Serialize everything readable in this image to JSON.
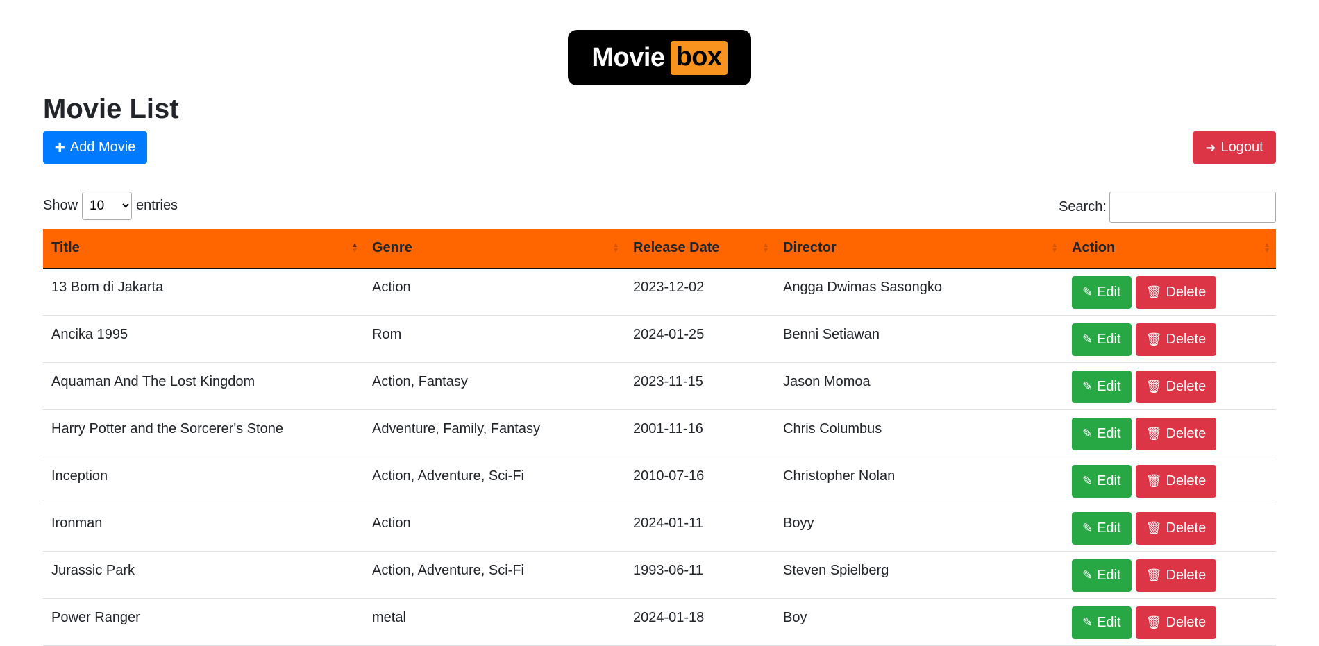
{
  "logo": {
    "word1": "Movie",
    "word2": "box"
  },
  "page_title": "Movie List",
  "buttons": {
    "add_movie": "Add Movie",
    "logout": "Logout"
  },
  "icons": {
    "plus": "plus-icon",
    "logout": "sign-out-icon",
    "edit": "edit-icon",
    "delete": "trash-icon"
  },
  "colors": {
    "header_bg": "#ff6600",
    "primary": "#007bff",
    "success": "#28a745",
    "danger": "#dc3545"
  },
  "controls": {
    "show_label": "Show",
    "entries_label": "entries",
    "page_length": "10",
    "search_label": "Search:",
    "search_value": ""
  },
  "table": {
    "columns": [
      "Title",
      "Genre",
      "Release Date",
      "Director",
      "Action"
    ],
    "sorted_column": "Title",
    "sort_direction": "ascending",
    "edit_label": "Edit",
    "delete_label": "Delete",
    "rows": [
      {
        "title": "13 Bom di Jakarta",
        "genre": "Action",
        "release_date": "2023-12-02",
        "director": "Angga Dwimas Sasongko"
      },
      {
        "title": "Ancika 1995",
        "genre": "Rom",
        "release_date": "2024-01-25",
        "director": "Benni Setiawan"
      },
      {
        "title": "Aquaman And The Lost Kingdom",
        "genre": "Action, Fantasy",
        "release_date": "2023-11-15",
        "director": "Jason Momoa"
      },
      {
        "title": "Harry Potter and the Sorcerer's Stone",
        "genre": "Adventure, Family, Fantasy",
        "release_date": "2001-11-16",
        "director": "Chris Columbus"
      },
      {
        "title": "Inception",
        "genre": "Action, Adventure, Sci-Fi",
        "release_date": "2010-07-16",
        "director": "Christopher Nolan"
      },
      {
        "title": "Ironman",
        "genre": "Action",
        "release_date": "2024-01-11",
        "director": "Boyy"
      },
      {
        "title": "Jurassic Park",
        "genre": "Action, Adventure, Sci-Fi",
        "release_date": "1993-06-11",
        "director": "Steven Spielberg"
      },
      {
        "title": "Power Ranger",
        "genre": "metal",
        "release_date": "2024-01-18",
        "director": "Boy"
      }
    ]
  }
}
